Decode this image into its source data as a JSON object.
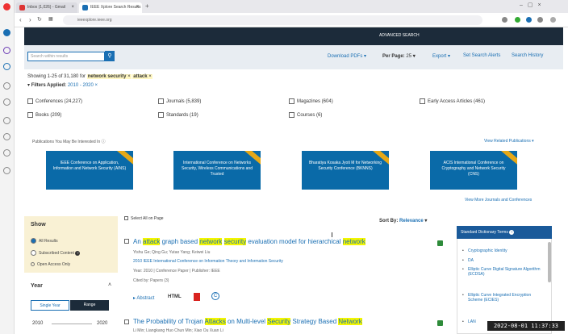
{
  "browser": {
    "tabs": [
      {
        "label": "Inbox (1,026) - Gmail"
      },
      {
        "label": "IEEE Xplore Search Results"
      }
    ],
    "url": "ieeexplore.ieee.org"
  },
  "header": {
    "advanced_search": "ADVANCED SEARCH"
  },
  "search": {
    "placeholder": "Search within results",
    "download_pdfs": "Download PDFs",
    "per_page_label": "Per Page:",
    "per_page_value": "25",
    "export": "Export",
    "set_alerts": "Set Search Alerts",
    "search_history": "Search History"
  },
  "results": {
    "showing": "Showing 1-25 of 31,180 for",
    "term1": "network security",
    "term2": "attack",
    "filters_applied": "Filters Applied:",
    "year_filter": "2010 - 2020"
  },
  "content_types": [
    "Conferences (24,227)",
    "Journals (5,839)",
    "Magazines (604)",
    "Early Access Articles (461)",
    "Books (209)",
    "Standards (19)",
    "Courses (6)"
  ],
  "promo": {
    "label": "Publications You May Be Interested In",
    "view_related": "View Related Publications",
    "view_more": "View More Journals and Conferences",
    "cards": [
      "IEEE Conference on Application, Information and Network Security (AINS)",
      "International Conference on Networks Security, Wireless Communications and Trusted",
      "Bharatiya Kosaka Jyoti M for Networking Security Conference (BKNNS)",
      "ACIS International Conference on Cryptography and Network Security (CNS)"
    ]
  },
  "show_filter": {
    "title": "Show",
    "options": [
      "All Results",
      "Subscribed Content",
      "Open Access Only"
    ]
  },
  "year_filter": {
    "title": "Year",
    "single_year": "Single Year",
    "range": "Range",
    "from": "2010",
    "to": "2020"
  },
  "list": {
    "select_all": "Select All on Page",
    "sort_label": "Sort By:",
    "sort_value": "Relevance"
  },
  "result1": {
    "title_parts": [
      "An ",
      "attack",
      " graph based ",
      "network",
      " ",
      "security",
      " evaluation model for hierarchical ",
      "network"
    ],
    "authors": "Yishu Ge; Qing Gu; Yutao Yang; Keiwei Liu",
    "venue": "2010 IEEE International Conference on Information Theory and Information Security",
    "meta": "Year: 2010 | Conference Paper | Publisher: IEEE",
    "cited": "Cited by: Papers (3)",
    "abstract": "Abstract",
    "html": "HTML"
  },
  "result2": {
    "title_parts": [
      "The Probability of Trojan ",
      "Attacks",
      " on Multi-level ",
      "Security",
      " Strategy Based ",
      "Network"
    ],
    "authors": "Li Min; Liangkang Huo Chun Min; Xiao Ou Xuan Li"
  },
  "dictionary": {
    "header": "Standard Dictionary Terms",
    "items": [
      "Cryptographic Identity",
      "DA",
      "Elliptic Curve Digital Signature Algorithm (ECDSA)",
      "Elliptic Curve Integrated Encryption Scheme (ECIES)",
      "LAN"
    ]
  },
  "clock": "2022-08-01 11:37:33"
}
